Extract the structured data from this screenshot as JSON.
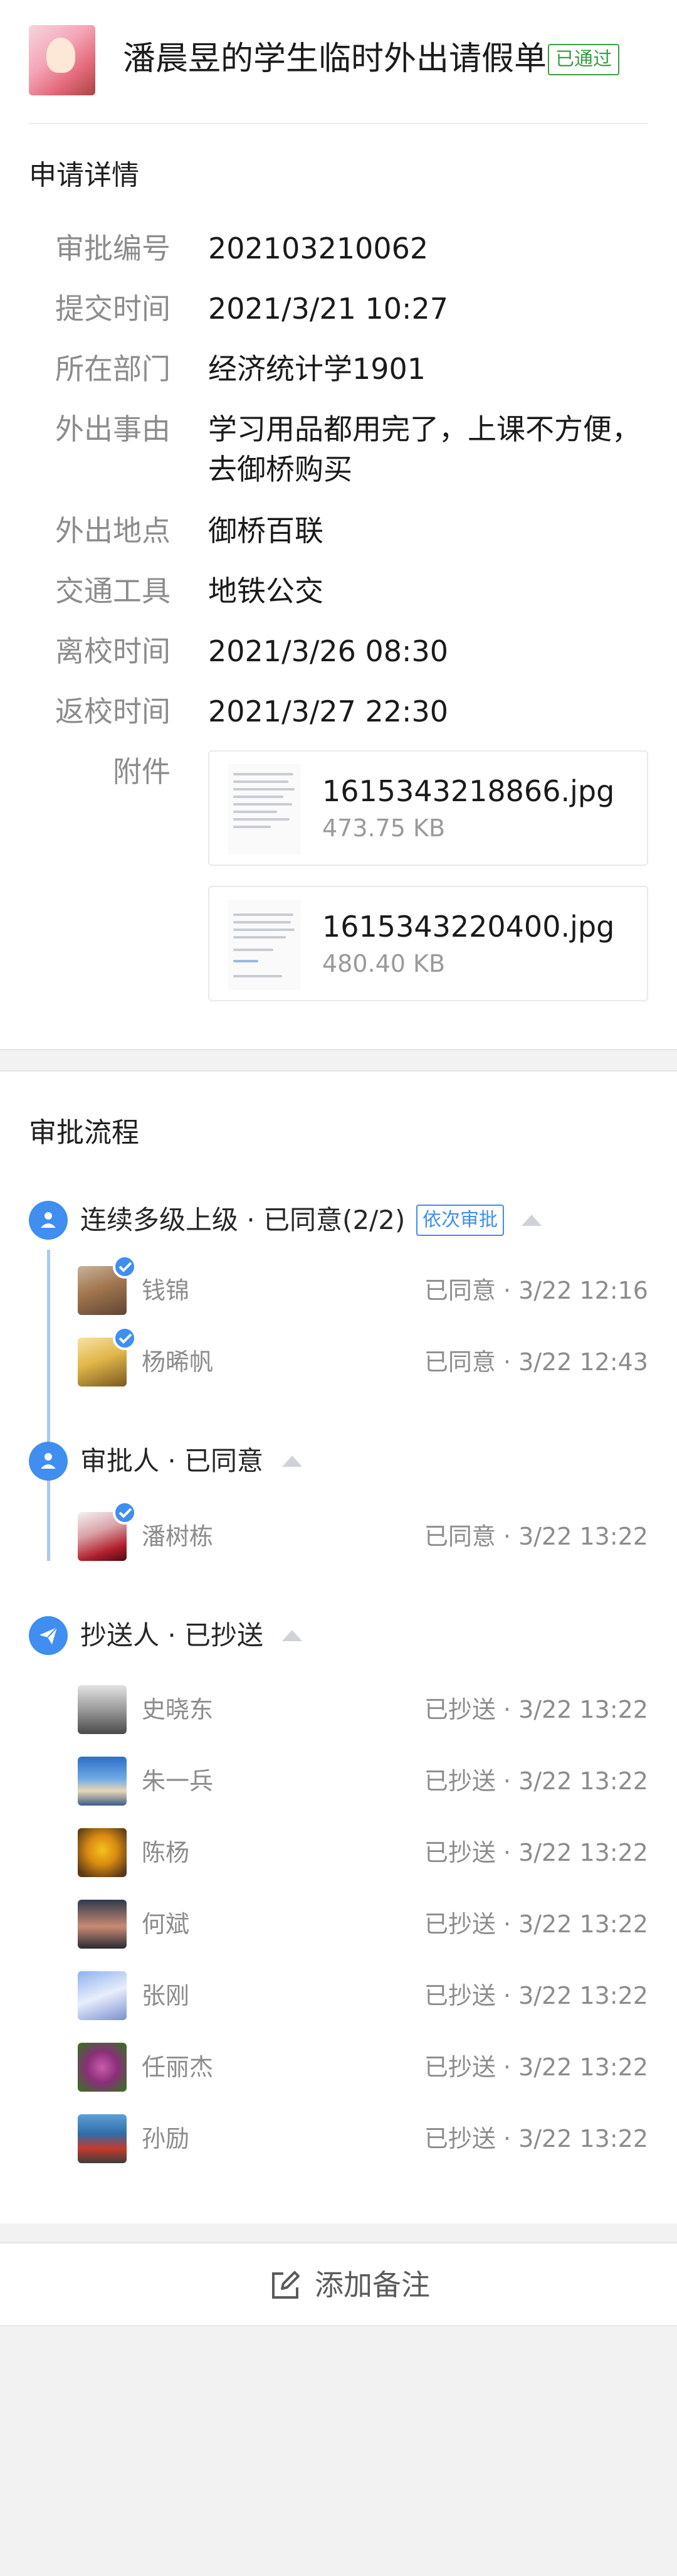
{
  "header": {
    "title": "潘晨昱的学生临时外出请假单",
    "status_tag": "已通过"
  },
  "details": {
    "section_title": "申请详情",
    "rows": [
      {
        "label": "审批编号",
        "value": "202103210062"
      },
      {
        "label": "提交时间",
        "value": "2021/3/21 10:27"
      },
      {
        "label": "所在部门",
        "value": "经济统计学1901"
      },
      {
        "label": "外出事由",
        "value": "学习用品都用完了，上课不方便，去御桥购买"
      },
      {
        "label": "外出地点",
        "value": "御桥百联"
      },
      {
        "label": "交通工具",
        "value": "地铁公交"
      },
      {
        "label": "离校时间",
        "value": "2021/3/26 08:30"
      },
      {
        "label": "返校时间",
        "value": "2021/3/27 22:30"
      }
    ],
    "attachment_label": "附件",
    "attachments": [
      {
        "name": "1615343218866.jpg",
        "size": "473.75 KB"
      },
      {
        "name": "1615343220400.jpg",
        "size": "480.40 KB"
      }
    ]
  },
  "flow": {
    "section_title": "审批流程",
    "nodes": [
      {
        "title": "连续多级上级 · 已同意(2/2)",
        "tag": "依次审批",
        "icon": "user-icon",
        "people": [
          {
            "name": "钱锦",
            "status": "已同意 · 3/22 12:16"
          },
          {
            "name": "杨晞帆",
            "status": "已同意 · 3/22 12:43"
          }
        ]
      },
      {
        "title": "审批人 · 已同意",
        "icon": "user-icon",
        "people": [
          {
            "name": "潘树栋",
            "status": "已同意 · 3/22 13:22"
          }
        ]
      },
      {
        "title": "抄送人 · 已抄送",
        "icon": "send-icon",
        "people": [
          {
            "name": "史晓东",
            "status": "已抄送 · 3/22 13:22"
          },
          {
            "name": "朱一兵",
            "status": "已抄送 · 3/22 13:22"
          },
          {
            "name": "陈杨",
            "status": "已抄送 · 3/22 13:22"
          },
          {
            "name": "何斌",
            "status": "已抄送 · 3/22 13:22"
          },
          {
            "name": "张刚",
            "status": "已抄送 · 3/22 13:22"
          },
          {
            "name": "任丽杰",
            "status": "已抄送 · 3/22 13:22"
          },
          {
            "name": "孙励",
            "status": "已抄送 · 3/22 13:22"
          }
        ]
      }
    ]
  },
  "footer": {
    "add_note_label": "添加备注",
    "icon": "edit-icon"
  },
  "colors": {
    "accent": "#3f8ef0",
    "approved": "#3a9d44",
    "muted": "#8c8c8c"
  }
}
